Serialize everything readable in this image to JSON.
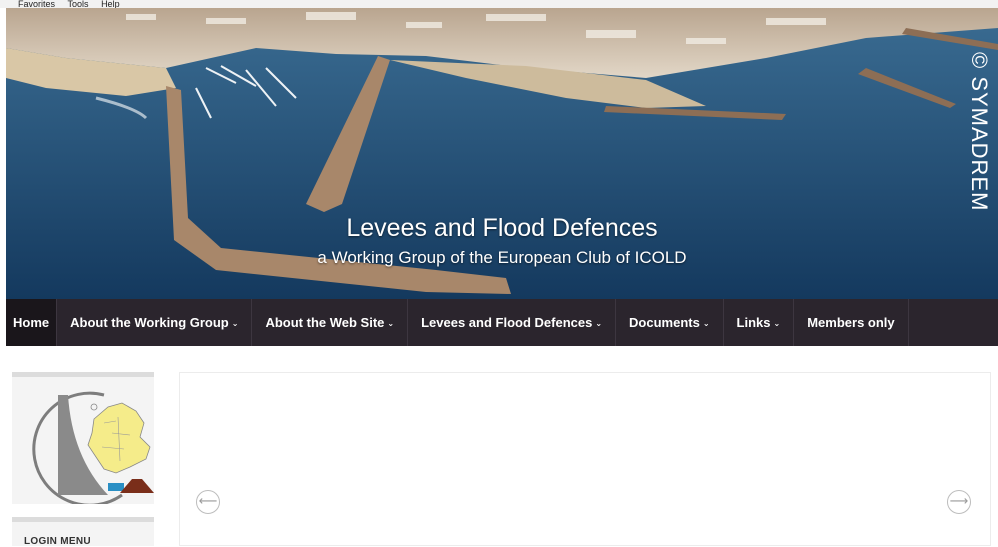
{
  "browser_menu": [
    "Favorites",
    "Tools",
    "Help"
  ],
  "banner": {
    "title": "Levees and Flood Defences",
    "subtitle": "a Working Group of the European Club of ICOLD",
    "watermark": "© SYMADREM"
  },
  "nav": {
    "items": [
      {
        "label": "Home",
        "dropdown": false,
        "active": true
      },
      {
        "label": "About the Working Group",
        "dropdown": true,
        "active": false
      },
      {
        "label": "About the Web Site",
        "dropdown": true,
        "active": false
      },
      {
        "label": "Levees and Flood Defences",
        "dropdown": true,
        "active": false
      },
      {
        "label": "Documents",
        "dropdown": true,
        "active": false
      },
      {
        "label": "Links",
        "dropdown": true,
        "active": false
      },
      {
        "label": "Members only",
        "dropdown": false,
        "active": false
      }
    ]
  },
  "sidebar": {
    "login_title": "LOGIN MENU"
  },
  "slider": {
    "prev_icon": "arrow-left-circle-icon",
    "next_icon": "arrow-right-circle-icon"
  },
  "colors": {
    "nav_bg": "#2b252d",
    "nav_active_bg": "#1a161b",
    "sea": "#1b4a73"
  }
}
